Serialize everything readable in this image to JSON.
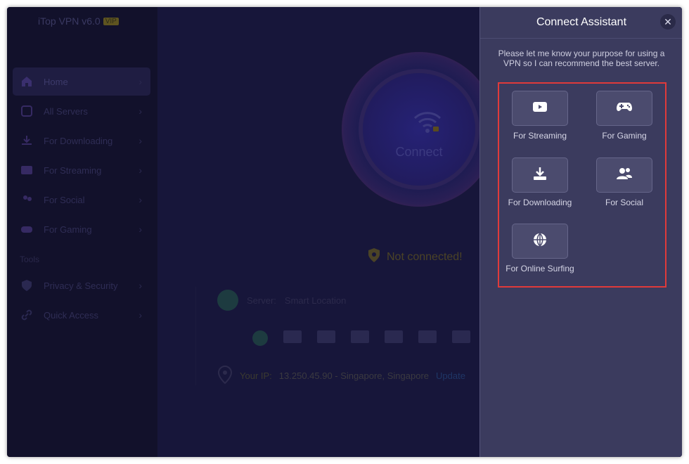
{
  "app": {
    "title": "iTop VPN v6.0",
    "badge": "VIP"
  },
  "sidebar": {
    "items": [
      {
        "label": "Home",
        "icon": "home-icon"
      },
      {
        "label": "All Servers",
        "icon": "servers-icon"
      },
      {
        "label": "For Downloading",
        "icon": "download-icon"
      },
      {
        "label": "For Streaming",
        "icon": "play-icon"
      },
      {
        "label": "For Social",
        "icon": "social-icon"
      },
      {
        "label": "For Gaming",
        "icon": "gamepad-icon"
      }
    ],
    "tools_title": "Tools",
    "tools": [
      {
        "label": "Privacy & Security",
        "icon": "shield-icon"
      },
      {
        "label": "Quick Access",
        "icon": "link-icon"
      }
    ]
  },
  "main": {
    "connect_label": "Connect",
    "status": "Not connected!",
    "server_label": "Server:",
    "server_value": "Smart Location",
    "ip_label": "Your IP:",
    "ip_value": "13.250.45.90 - Singapore, Singapore",
    "ip_link": "Update"
  },
  "assistant": {
    "title": "Connect Assistant",
    "close_symbol": "✕",
    "description": "Please let me know your purpose for using a VPN so I can recommend the best server.",
    "options": [
      {
        "label": "For Streaming",
        "icon": "youtube-play-icon"
      },
      {
        "label": "For Gaming",
        "icon": "gamepad-icon"
      },
      {
        "label": "For Downloading",
        "icon": "download-icon"
      },
      {
        "label": "For Social",
        "icon": "people-icon"
      },
      {
        "label": "For Online Surfing",
        "icon": "globe-icon"
      }
    ]
  },
  "colors": {
    "panel_bg": "#3b3b5e",
    "highlight_border": "#e03a3a",
    "window_bg": "#161432"
  }
}
